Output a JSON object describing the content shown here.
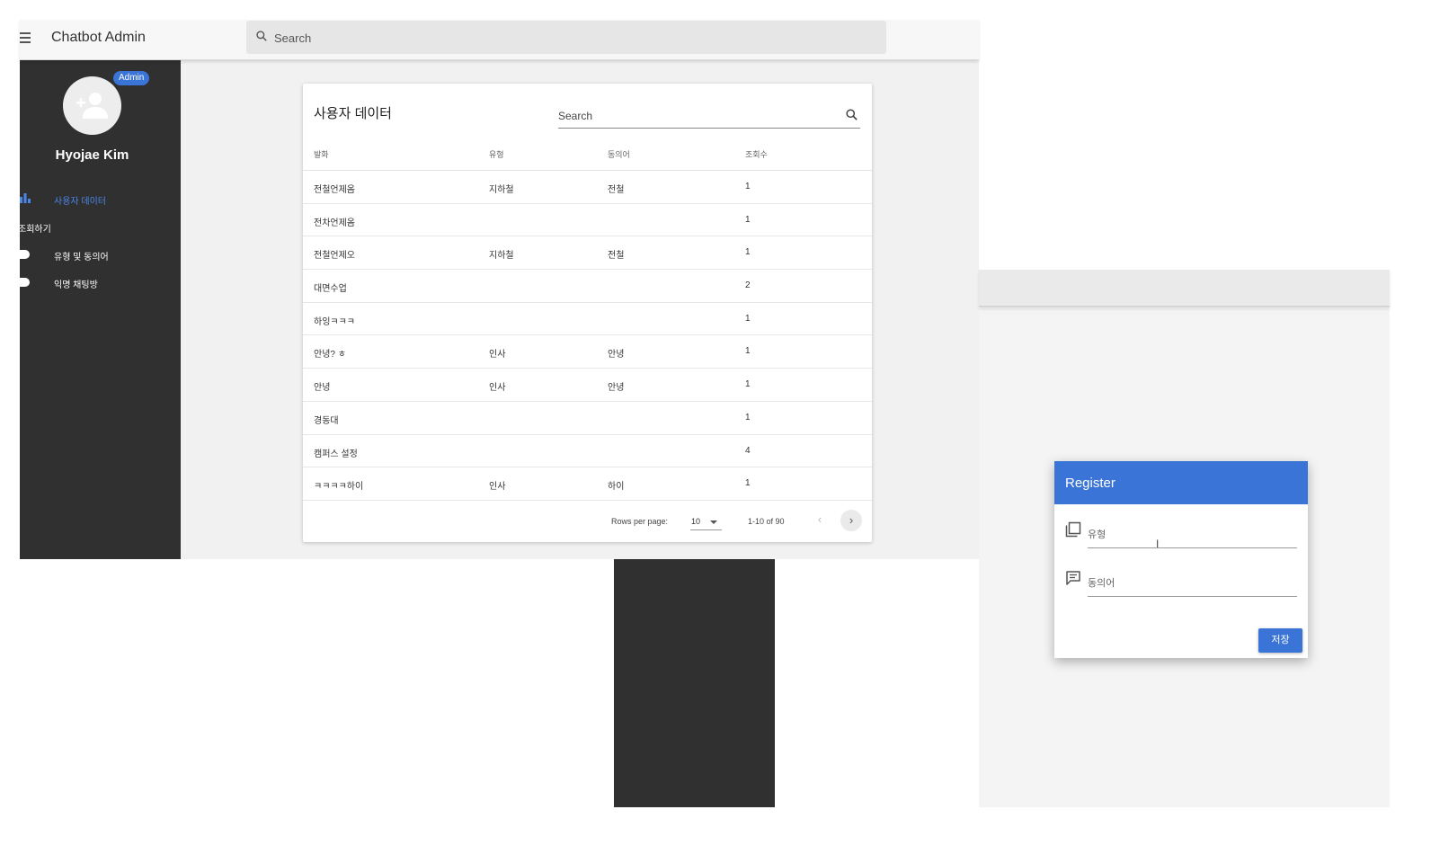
{
  "app": {
    "title": "Chatbot Admin",
    "search_placeholder": "Search"
  },
  "sidebar": {
    "badge": "Admin",
    "user_name": "Hyojae Kim",
    "items": [
      {
        "label": "사용자 데이터",
        "active": true
      },
      {
        "label": "조회하기"
      },
      {
        "label": "유형 및 동의어"
      },
      {
        "label": "익명 채팅방"
      }
    ]
  },
  "card": {
    "title": "사용자 데이터",
    "search_placeholder": "Search",
    "columns": [
      "발화",
      "유형",
      "동의어",
      "조회수"
    ],
    "rows": [
      [
        "전철언제옴",
        "지하철",
        "전철",
        "1"
      ],
      [
        "전차언제옴",
        "",
        "",
        "1"
      ],
      [
        "전철언제오",
        "지하철",
        "전철",
        "1"
      ],
      [
        "대면수업",
        "",
        "",
        "2"
      ],
      [
        "하잉ㅋㅋㅋ",
        "",
        "",
        "1"
      ],
      [
        "안녕? ㅎ",
        "인사",
        "안녕",
        "1"
      ],
      [
        "안녕",
        "인사",
        "안녕",
        "1"
      ],
      [
        "경동대",
        "",
        "",
        "1"
      ],
      [
        "캠퍼스 설정",
        "",
        "",
        "4"
      ],
      [
        "ㅋㅋㅋㅋ하이",
        "인사",
        "하이",
        "1"
      ]
    ],
    "pagination": {
      "rows_per_page_label": "Rows per page:",
      "rows_per_page": "10",
      "range": "1-10 of 90",
      "prev_icon": "‹",
      "next_icon": "›"
    }
  },
  "dialog": {
    "title": "Register",
    "type_label": "유형",
    "synonym_label": "동의어",
    "save_label": "저장",
    "text_cursor": "I"
  },
  "colors": {
    "accent": "#3a74d6",
    "sidebar": "#303030"
  }
}
